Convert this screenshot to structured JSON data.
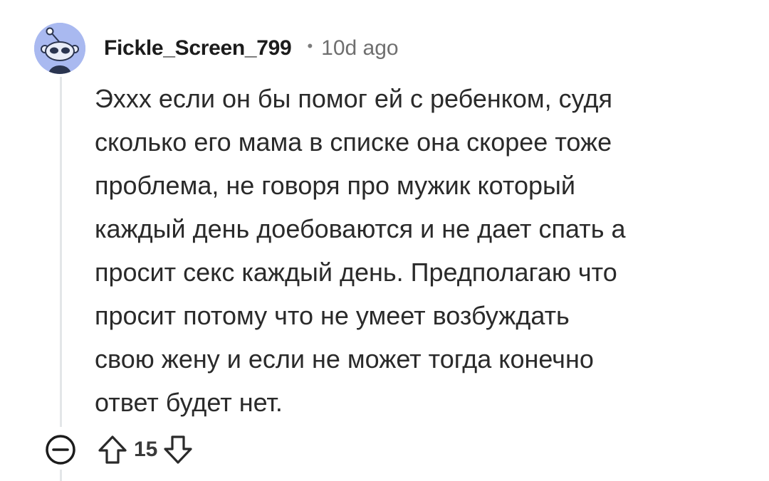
{
  "comment": {
    "author": "Fickle_Screen_799",
    "separator": "•",
    "timestamp": "10d ago",
    "body": "Эххх если он бы помог ей с ребенком, судя\nсколько его мама в списке она скорее тоже\nпроблема, не говоря про мужик который\nкаждый день доебоваются и не дает спать а\nпросит секс каждый день. Предполагаю что\nпросит потому что не умеет возбуждать\nсвою жену и если не может тогда конечно\nответ будет нет.",
    "vote_count": "15"
  },
  "icons": {
    "avatar": "snoo-avatar-icon",
    "collapse": "collapse-minus-circle-icon",
    "upvote": "upvote-arrow-icon",
    "downvote": "downvote-arrow-icon"
  },
  "colors": {
    "avatar_background": "#a9b9f0",
    "thread_line": "#e3e6e8",
    "text": "#2a2a2a",
    "muted": "#6f6f6f"
  }
}
